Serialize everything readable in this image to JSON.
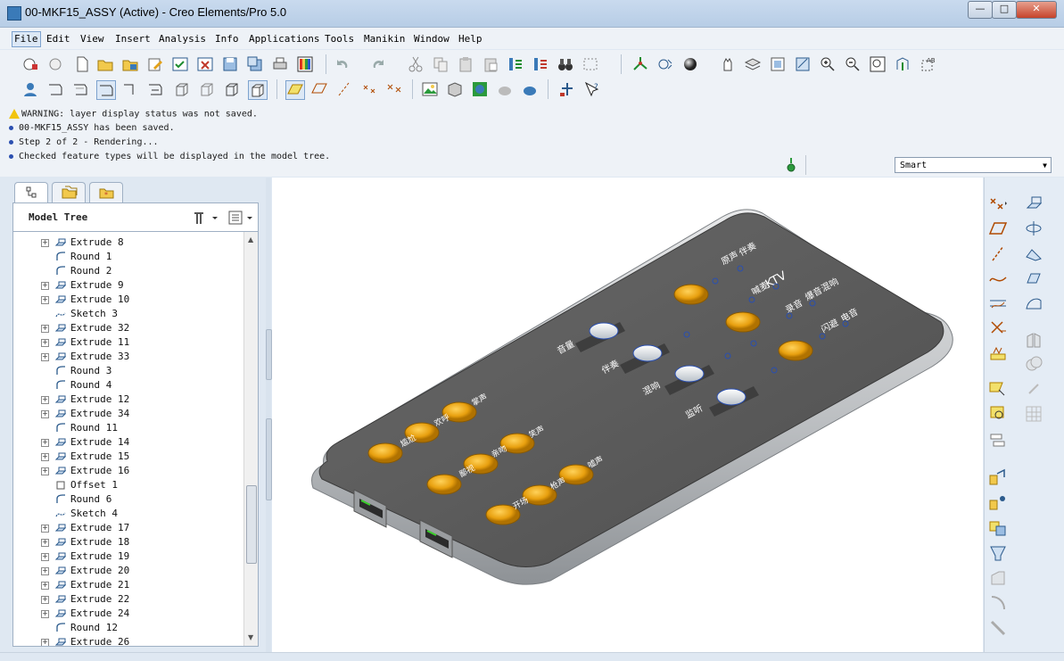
{
  "window": {
    "title": "00-MKF15_ASSY (Active) - Creo Elements/Pro 5.0"
  },
  "menu": [
    "File",
    "Edit",
    "View",
    "Insert",
    "Analysis",
    "Info",
    "Applications",
    "Tools",
    "Manikin",
    "Window",
    "Help"
  ],
  "messages": [
    {
      "kind": "warning",
      "text": "WARNING: layer display status was not saved."
    },
    {
      "kind": "info",
      "text": "00-MKF15_ASSY has been saved."
    },
    {
      "kind": "info",
      "text": "Step 2 of 2 - Rendering..."
    },
    {
      "kind": "info",
      "text": "Checked feature types will be displayed in the model tree."
    }
  ],
  "selection_filter": {
    "value": "Smart"
  },
  "model_tree": {
    "title": "Model Tree",
    "items": [
      {
        "label": "Extrude 8",
        "type": "extrude",
        "expandable": true
      },
      {
        "label": "Round 1",
        "type": "round",
        "expandable": false
      },
      {
        "label": "Round 2",
        "type": "round",
        "expandable": false
      },
      {
        "label": "Extrude 9",
        "type": "extrude",
        "expandable": true
      },
      {
        "label": "Extrude 10",
        "type": "extrude",
        "expandable": true
      },
      {
        "label": "Sketch 3",
        "type": "sketch",
        "expandable": false
      },
      {
        "label": "Extrude 32",
        "type": "extrude",
        "expandable": true
      },
      {
        "label": "Extrude 11",
        "type": "extrude",
        "expandable": true
      },
      {
        "label": "Extrude 33",
        "type": "extrude",
        "expandable": true
      },
      {
        "label": "Round 3",
        "type": "round",
        "expandable": false
      },
      {
        "label": "Round 4",
        "type": "round",
        "expandable": false
      },
      {
        "label": "Extrude 12",
        "type": "extrude",
        "expandable": true
      },
      {
        "label": "Extrude 34",
        "type": "extrude",
        "expandable": true
      },
      {
        "label": "Round 11",
        "type": "round",
        "expandable": false
      },
      {
        "label": "Extrude 14",
        "type": "extrude",
        "expandable": true
      },
      {
        "label": "Extrude 15",
        "type": "extrude",
        "expandable": true
      },
      {
        "label": "Extrude 16",
        "type": "extrude",
        "expandable": true
      },
      {
        "label": "Offset 1",
        "type": "offset",
        "expandable": false
      },
      {
        "label": "Round 6",
        "type": "round",
        "expandable": false
      },
      {
        "label": "Sketch 4",
        "type": "sketch",
        "expandable": false
      },
      {
        "label": "Extrude 17",
        "type": "extrude",
        "expandable": true
      },
      {
        "label": "Extrude 18",
        "type": "extrude",
        "expandable": true
      },
      {
        "label": "Extrude 19",
        "type": "extrude",
        "expandable": true
      },
      {
        "label": "Extrude 20",
        "type": "extrude",
        "expandable": true
      },
      {
        "label": "Extrude 21",
        "type": "extrude",
        "expandable": true
      },
      {
        "label": "Extrude 22",
        "type": "extrude",
        "expandable": true
      },
      {
        "label": "Extrude 24",
        "type": "extrude",
        "expandable": true
      },
      {
        "label": "Round 12",
        "type": "round",
        "expandable": false
      },
      {
        "label": "Extrude 26",
        "type": "extrude",
        "expandable": true
      }
    ]
  },
  "model": {
    "labels": {
      "brand": "KTV",
      "lbl1": "原声",
      "lbl2": "伴奏",
      "lbl3": "喊麦",
      "lbl4": "爆音",
      "lbl5": "录音",
      "lbl6": "混响",
      "lbl7": "闪避",
      "lbl8": "电音",
      "lbl9": "音量",
      "lbl10": "伴奏",
      "lbl11": "混响",
      "lbl12": "监听",
      "lbl13": "掌声",
      "lbl14": "欢呼",
      "lbl15": "尴尬",
      "lbl16": "笑声",
      "lbl17": "亲吻",
      "lbl18": "鄙视",
      "lbl19": "嘘声",
      "lbl20": "枪声",
      "lbl21": "开场"
    }
  },
  "colors": {
    "body": "#5b5b5b",
    "button": "#e8a00f",
    "rim": "#c2c4c6",
    "accent": "#3a7ab8"
  }
}
